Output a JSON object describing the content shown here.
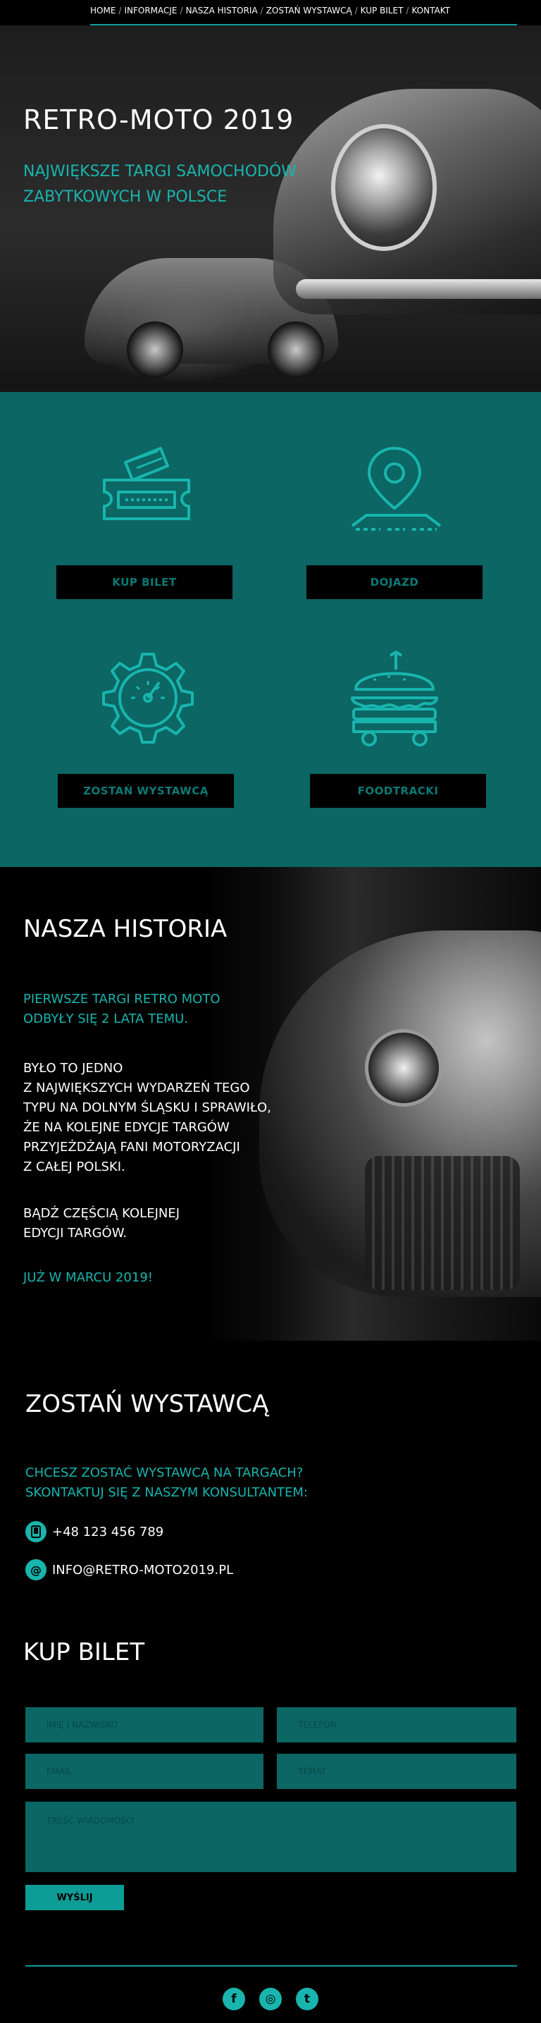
{
  "nav": {
    "items": [
      "HOME",
      "INFORMACJE",
      "NASZA HISTORIA",
      "ZOSTAŃ WYSTAWCĄ",
      "KUP BILET",
      "KONTAKT"
    ],
    "separator": "/",
    "accent": "#0e9c97"
  },
  "hero": {
    "title": "RETRO-MOTO 2019",
    "subtitle_line1": "NAJWIĘKSZE TARGI SAMOCHODÓW",
    "subtitle_line2": "ZABYTKOWYCH W POLSCE"
  },
  "services": {
    "background": "#0b6664",
    "items": [
      {
        "label": "KUP BILET",
        "icon": "ticket-icon"
      },
      {
        "label": "DOJAZD",
        "icon": "map-pin-icon"
      },
      {
        "label": "ZOSTAŃ WYSTAWCĄ",
        "icon": "gear-gauge-icon"
      },
      {
        "label": "FOODTRACKI",
        "icon": "food-truck-icon"
      }
    ]
  },
  "history": {
    "title": "NASZA HISTORIA",
    "teal_line1": "PIERWSZE TARGI RETRO MOTO",
    "teal_line2": "ODBYŁY SIĘ 2 LATA TEMU.",
    "p1_lines": [
      "BYŁO TO JEDNO",
      "Z NAJWIĘKSZYCH WYDARZEŃ TEGO",
      "TYPU NA DOLNYM ŚLĄSKU I SPRAWIŁO,",
      "ŻE NA KOLEJNE EDYCJE TARGÓW",
      "PRZYJEŻDŻAJĄ FANI MOTORYZACJI",
      "Z CAŁEJ POLSKI."
    ],
    "p2_lines": [
      "BĄDŹ CZĘŚCIĄ KOLEJNEJ",
      "EDYCJI TARGÓW."
    ],
    "closing": "JUŻ W MARCU 2019!"
  },
  "exhibitor": {
    "title": "ZOSTAŃ WYSTAWCĄ",
    "teal_line1": "CHCESZ ZOSTAĆ WYSTAWCĄ NA TARGACH?",
    "teal_line2": "SKONTAKTUJ SIĘ Z NASZYM KONSULTANTEM:",
    "phone": "+48 123 456 789",
    "email": "INFO@RETRO-MOTO2019.PL"
  },
  "ticket_form": {
    "title": "KUP BILET",
    "name_placeholder": "IMIĘ I NAZWISKO",
    "phone_placeholder": "TELEFON",
    "email_placeholder": "EMAIL",
    "subject_placeholder": "TEMAT",
    "message_placeholder": "TREŚĆ WIADOMOŚCI",
    "submit_label": "WYŚLIJ"
  },
  "footer": {
    "socials": [
      {
        "label": "f",
        "icon": "facebook-icon"
      },
      {
        "label": "◎",
        "icon": "instagram-icon"
      },
      {
        "label": "t",
        "icon": "twitter-icon"
      }
    ]
  }
}
